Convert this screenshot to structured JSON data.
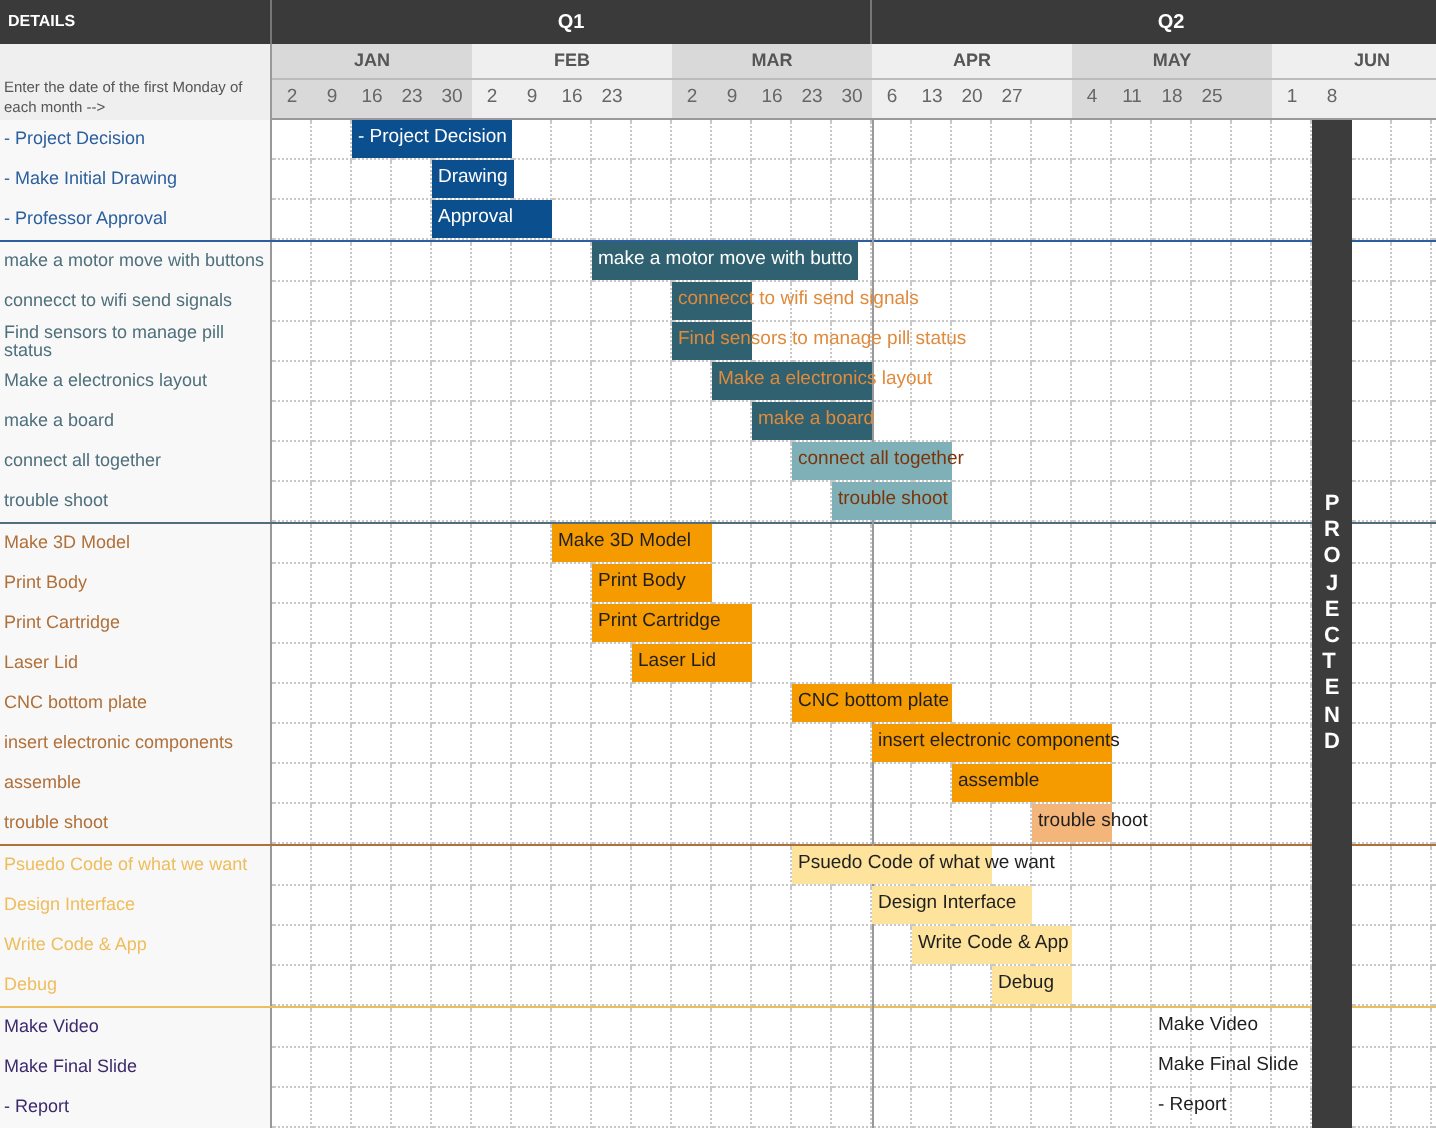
{
  "header": {
    "details": "DETAILS",
    "note": "Enter the date of the first Monday of each month -->",
    "quarters": [
      {
        "label": "Q1",
        "months": [
          {
            "label": "JAN",
            "days": [
              "2",
              "9",
              "16",
              "23",
              "30"
            ]
          },
          {
            "label": "FEB",
            "days": [
              "2",
              "9",
              "16",
              "23"
            ]
          },
          {
            "label": "MAR",
            "days": [
              "2",
              "9",
              "16",
              "23",
              "30"
            ]
          }
        ]
      },
      {
        "label": "Q2",
        "months": [
          {
            "label": "APR",
            "days": [
              "6",
              "13",
              "20",
              "27"
            ]
          },
          {
            "label": "MAY",
            "days": [
              "4",
              "11",
              "18",
              "25"
            ]
          },
          {
            "label": "JUN",
            "days": [
              "1",
              "8"
            ]
          }
        ]
      }
    ]
  },
  "sections": [
    {
      "kind": "planning",
      "color": "#2b5f9e",
      "tasks": [
        {
          "kind": "bar",
          "label": "- Project Decision",
          "bar_label": "- Project Decision",
          "faded": false,
          "white_text": true,
          "filled": [
            false,
            false,
            true,
            true,
            true,
            true
          ]
        },
        {
          "kind": "bar",
          "label": "- Make  Initial Drawing",
          "bar_label": "Drawing",
          "faded": false,
          "white_text": true,
          "filled": [
            false,
            false,
            false,
            false,
            true,
            true
          ]
        },
        {
          "kind": "bar",
          "label": "- Professor Approval",
          "bar_label": "Approval",
          "faded": false,
          "white_text": true,
          "filled": [
            false,
            false,
            false,
            false,
            true,
            true,
            true
          ]
        }
      ]
    },
    {
      "kind": "electronics",
      "color": "#4f6f7c",
      "tasks": [
        {
          "kind": "bar",
          "label": "make a motor move with buttons",
          "bar_label": "make a motor move with butto",
          "faded": false,
          "white_text": true,
          "filled": [
            false,
            false,
            false,
            false,
            false,
            false,
            false,
            false,
            true,
            true,
            true,
            true,
            true,
            true
          ]
        },
        {
          "kind": "bar",
          "label": "connecct to wifi send signals",
          "bar_label": "connecct to wifi send signals",
          "faded": false,
          "white_text": false,
          "filled": [
            false,
            false,
            false,
            false,
            false,
            false,
            false,
            false,
            false,
            false,
            true,
            true
          ]
        },
        {
          "kind": "bar",
          "label": "Find sensors to manage pill status",
          "bar_label": "Find sensors to manage pill status",
          "faded": false,
          "white_text": false,
          "filled": [
            false,
            false,
            false,
            false,
            false,
            false,
            false,
            false,
            false,
            false,
            true,
            true
          ]
        },
        {
          "kind": "bar",
          "label": "Make a electronics layout",
          "bar_label": "Make a electronics layout",
          "faded": false,
          "white_text": false,
          "filled": [
            false,
            false,
            false,
            false,
            false,
            false,
            false,
            false,
            false,
            false,
            false,
            true,
            true,
            true,
            true
          ]
        },
        {
          "kind": "bar",
          "label": "make a board",
          "bar_label": "make a board",
          "faded": false,
          "white_text": false,
          "filled": [
            false,
            false,
            false,
            false,
            false,
            false,
            false,
            false,
            false,
            false,
            false,
            false,
            true,
            true,
            true
          ]
        },
        {
          "kind": "bar",
          "label": "connect all together",
          "bar_label": "connect all together",
          "faded": true,
          "white_text": false,
          "filled": [
            false,
            false,
            false,
            false,
            false,
            false,
            false,
            false,
            false,
            false,
            false,
            false,
            false,
            true,
            true,
            true,
            true
          ]
        },
        {
          "kind": "bar",
          "label": "trouble shoot",
          "bar_label": "trouble shoot",
          "faded": true,
          "white_text": false,
          "filled": [
            false,
            false,
            false,
            false,
            false,
            false,
            false,
            false,
            false,
            false,
            false,
            false,
            false,
            false,
            true,
            true,
            true
          ]
        }
      ]
    },
    {
      "kind": "fabrication",
      "color": "#b0703a",
      "tasks": [
        {
          "kind": "bar",
          "label": "Make 3D Model",
          "bar_label": "Make 3D Model",
          "faded": false,
          "white_text": false,
          "filled": [
            false,
            false,
            false,
            false,
            false,
            false,
            false,
            true,
            true,
            true,
            true
          ]
        },
        {
          "kind": "bar",
          "label": "Print Body",
          "bar_label": "Print Body",
          "faded": false,
          "white_text": false,
          "filled": [
            false,
            false,
            false,
            false,
            false,
            false,
            false,
            false,
            true,
            true,
            true
          ]
        },
        {
          "kind": "bar",
          "label": "Print Cartridge",
          "bar_label": "Print Cartridge",
          "faded": false,
          "white_text": false,
          "filled": [
            false,
            false,
            false,
            false,
            false,
            false,
            false,
            false,
            true,
            true,
            true,
            true
          ]
        },
        {
          "kind": "bar",
          "label": "Laser Lid",
          "bar_label": "Laser Lid",
          "faded": false,
          "white_text": false,
          "filled": [
            false,
            false,
            false,
            false,
            false,
            false,
            false,
            false,
            false,
            true,
            true,
            true
          ]
        },
        {
          "kind": "bar",
          "label": "CNC bottom plate",
          "bar_label": "CNC bottom plate",
          "faded": false,
          "white_text": false,
          "filled": [
            false,
            false,
            false,
            false,
            false,
            false,
            false,
            false,
            false,
            false,
            false,
            false,
            false,
            true,
            true,
            true,
            true
          ]
        },
        {
          "kind": "bar",
          "label": "insert electronic components",
          "bar_label": "insert electronic components",
          "faded": false,
          "white_text": false,
          "filled": [
            false,
            false,
            false,
            false,
            false,
            false,
            false,
            false,
            false,
            false,
            false,
            false,
            false,
            false,
            false,
            true,
            true,
            true,
            true,
            true,
            true
          ]
        },
        {
          "kind": "bar",
          "label": "assemble",
          "bar_label": "assemble",
          "faded": false,
          "white_text": false,
          "filled": [
            false,
            false,
            false,
            false,
            false,
            false,
            false,
            false,
            false,
            false,
            false,
            false,
            false,
            false,
            false,
            false,
            false,
            true,
            true,
            true,
            true
          ]
        },
        {
          "kind": "bar",
          "label": "trouble shoot",
          "bar_label": "trouble shoot",
          "faded": true,
          "white_text": false,
          "filled": [
            false,
            false,
            false,
            false,
            false,
            false,
            false,
            false,
            false,
            false,
            false,
            false,
            false,
            false,
            false,
            false,
            false,
            false,
            false,
            true,
            true
          ]
        }
      ]
    },
    {
      "kind": "software",
      "color": "#eebd5c",
      "tasks": [
        {
          "kind": "bar",
          "label": "Psuedo Code of what we want",
          "bar_label": "Psuedo Code of what we want",
          "faded": false,
          "white_text": false,
          "filled": [
            false,
            false,
            false,
            false,
            false,
            false,
            false,
            false,
            false,
            false,
            false,
            false,
            false,
            true,
            true,
            true,
            true,
            true
          ]
        },
        {
          "kind": "bar",
          "label": "Design Interface",
          "bar_label": "Design Interface",
          "faded": false,
          "white_text": false,
          "filled": [
            false,
            false,
            false,
            false,
            false,
            false,
            false,
            false,
            false,
            false,
            false,
            false,
            false,
            false,
            false,
            true,
            true,
            true,
            true
          ]
        },
        {
          "kind": "bar",
          "label": "Write Code & App",
          "bar_label": "Write Code & App",
          "faded": false,
          "white_text": false,
          "filled": [
            false,
            false,
            false,
            false,
            false,
            false,
            false,
            false,
            false,
            false,
            false,
            false,
            false,
            false,
            false,
            false,
            true,
            true,
            true,
            true
          ]
        },
        {
          "kind": "bar",
          "label": "Debug",
          "bar_label": "Debug",
          "faded": false,
          "white_text": false,
          "filled": [
            false,
            false,
            false,
            false,
            false,
            false,
            false,
            false,
            false,
            false,
            false,
            false,
            false,
            false,
            false,
            false,
            false,
            false,
            true,
            true
          ]
        }
      ]
    },
    {
      "kind": "presentation",
      "color": "#3c2a6e",
      "tasks": [
        {
          "kind": "note",
          "label": "Make Video",
          "bar_label": "Make Video",
          "filled": [
            false,
            false,
            false,
            false,
            false,
            false,
            false,
            false,
            false,
            false,
            false,
            false,
            false,
            false,
            false,
            false,
            false,
            false,
            false,
            false,
            false,
            false,
            true
          ]
        },
        {
          "kind": "note",
          "label": "Make Final Slide",
          "bar_label": "Make Final Slide",
          "filled": [
            false,
            false,
            false,
            false,
            false,
            false,
            false,
            false,
            false,
            false,
            false,
            false,
            false,
            false,
            false,
            false,
            false,
            false,
            false,
            false,
            false,
            false,
            true
          ]
        },
        {
          "kind": "note",
          "label": "- Report",
          "bar_label": "- Report",
          "filled": [
            false,
            false,
            false,
            false,
            false,
            false,
            false,
            false,
            false,
            false,
            false,
            false,
            false,
            false,
            false,
            false,
            false,
            false,
            false,
            false,
            false,
            false,
            true
          ]
        }
      ]
    }
  ],
  "project_end": {
    "label": "PROJECT END"
  }
}
